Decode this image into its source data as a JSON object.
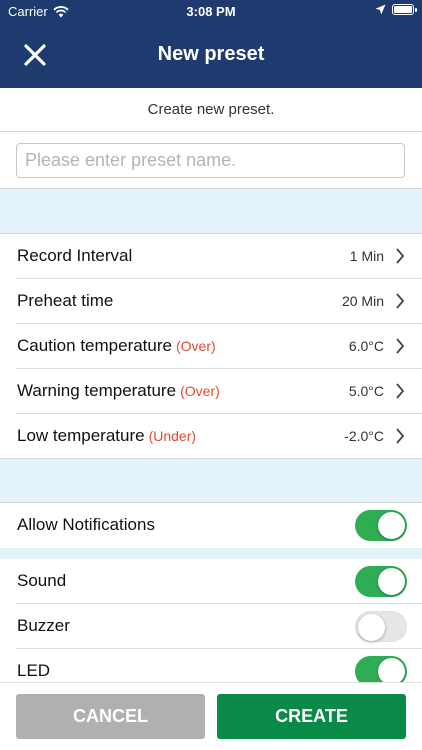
{
  "status_bar": {
    "carrier": "Carrier",
    "time": "3:08 PM",
    "wifi_icon": "wifi-icon",
    "location_icon": "location-arrow-icon",
    "battery_icon": "battery-icon"
  },
  "header": {
    "title": "New preset",
    "close_icon": "close-icon",
    "background": "#1f3a6e"
  },
  "subtitle": "Create new preset.",
  "name_field": {
    "value": "",
    "placeholder": "Please enter preset name."
  },
  "settings": [
    {
      "label": "Record Interval",
      "qualifier": "",
      "value": "1 Min"
    },
    {
      "label": "Preheat time",
      "qualifier": "",
      "value": "20 Min"
    },
    {
      "label": "Caution temperature",
      "qualifier": "(Over)",
      "value": "6.0°C"
    },
    {
      "label": "Warning temperature",
      "qualifier": "(Over)",
      "value": "5.0°C"
    },
    {
      "label": "Low temperature",
      "qualifier": "(Under)",
      "value": "-2.0°C"
    }
  ],
  "notifications": {
    "allow": {
      "label": "Allow Notifications",
      "on": true
    },
    "items": [
      {
        "label": "Sound",
        "on": true
      },
      {
        "label": "Buzzer",
        "on": false
      },
      {
        "label": "LED",
        "on": true
      }
    ]
  },
  "buttons": {
    "cancel": "CANCEL",
    "create": "CREATE"
  },
  "colors": {
    "header": "#1f3a6e",
    "section_bg": "#e3f2fb",
    "qualifier": "#e5482f",
    "toggle_on": "#2fad55",
    "create_button": "#0a8a47",
    "cancel_button": "#b0b0b0"
  }
}
